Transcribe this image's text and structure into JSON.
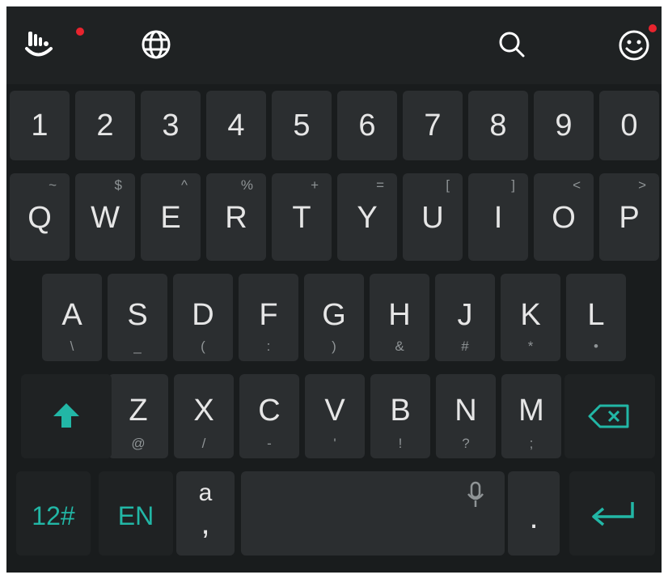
{
  "colors": {
    "background": "#191c1d",
    "key": "#2b2e30",
    "accent": "#22b7a6",
    "notification": "#e8242e",
    "text": "#e6e6e6"
  },
  "toolbar": {
    "logo_icon": "touchpal-logo-icon",
    "globe_icon": "globe-icon",
    "search_icon": "search-icon",
    "emoji_icon": "emoji-icon"
  },
  "number_row": [
    "1",
    "2",
    "3",
    "4",
    "5",
    "6",
    "7",
    "8",
    "9",
    "0"
  ],
  "row1": [
    {
      "key": "Q",
      "alt": "~"
    },
    {
      "key": "W",
      "alt": "$"
    },
    {
      "key": "E",
      "alt": "^"
    },
    {
      "key": "R",
      "alt": "%"
    },
    {
      "key": "T",
      "alt": "+"
    },
    {
      "key": "Y",
      "alt": "="
    },
    {
      "key": "U",
      "alt": "["
    },
    {
      "key": "I",
      "alt": "]"
    },
    {
      "key": "O",
      "alt": "<"
    },
    {
      "key": "P",
      "alt": ">"
    }
  ],
  "row2": [
    {
      "key": "A",
      "alt": "\\"
    },
    {
      "key": "S",
      "alt": "_"
    },
    {
      "key": "D",
      "alt": "("
    },
    {
      "key": "F",
      "alt": ":"
    },
    {
      "key": "G",
      "alt": ")"
    },
    {
      "key": "H",
      "alt": "&"
    },
    {
      "key": "J",
      "alt": "#"
    },
    {
      "key": "K",
      "alt": "*"
    },
    {
      "key": "L",
      "alt": "•"
    }
  ],
  "row3": [
    {
      "key": "Z",
      "alt": "@"
    },
    {
      "key": "X",
      "alt": "/"
    },
    {
      "key": "C",
      "alt": "-"
    },
    {
      "key": "V",
      "alt": "'"
    },
    {
      "key": "B",
      "alt": "!"
    },
    {
      "key": "N",
      "alt": "?"
    },
    {
      "key": "M",
      "alt": ";"
    }
  ],
  "bottom": {
    "symbols_label": "12#",
    "language_label": "EN",
    "autocorrect_label": "a",
    "comma_label": ",",
    "period_label": "."
  }
}
